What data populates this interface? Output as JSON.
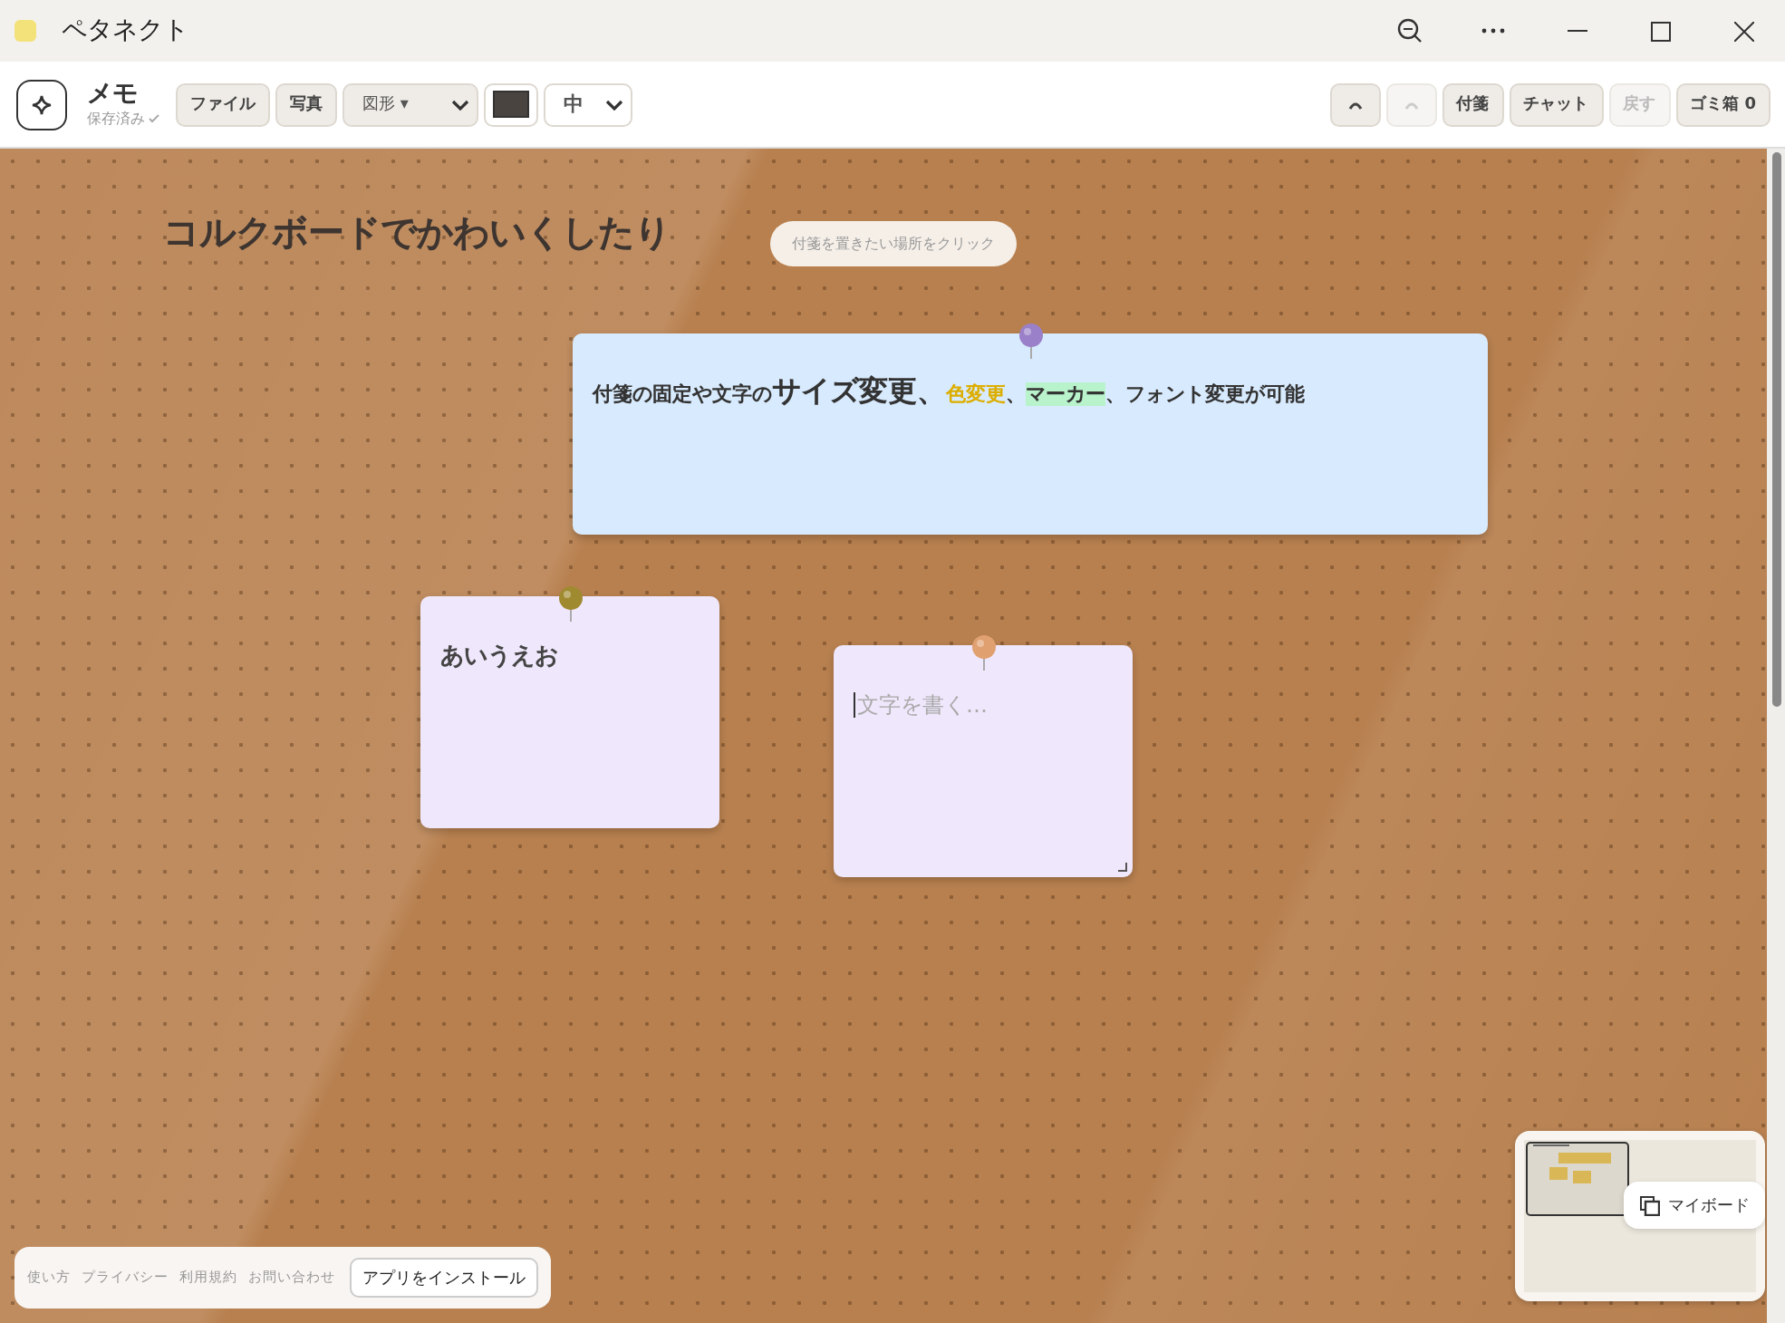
{
  "window": {
    "title": "ペタネクト"
  },
  "toolbar": {
    "app_name": "メモ",
    "save_status": "保存済み",
    "buttons_left": [
      {
        "label": "ファイル"
      },
      {
        "label": "写真"
      }
    ],
    "shape_select": {
      "value": "図形 ▾"
    },
    "pen": {
      "color": "#4a4440"
    },
    "size_select": {
      "value": "中"
    },
    "buttons_right": [
      {
        "kind": "undo",
        "disabled": false
      },
      {
        "kind": "redo",
        "disabled": true
      },
      {
        "kind": "text",
        "label": "付箋",
        "disabled": false
      },
      {
        "kind": "text",
        "label": "チャット",
        "disabled": false
      },
      {
        "kind": "text",
        "label": "戻す",
        "disabled": true
      },
      {
        "kind": "text",
        "label": "ゴミ箱 0",
        "disabled": false
      }
    ]
  },
  "board": {
    "heading": "コルクボードでかわいくしたり",
    "hint": "付箋を置きたい場所をクリック",
    "notes": [
      {
        "color": "#d8eafd",
        "pin": {
          "color": "#9a80c8"
        },
        "segments": [
          {
            "kind": "plain",
            "text": "付箋の固定や文字の"
          },
          {
            "kind": "big",
            "text": "サイズ変更、"
          },
          {
            "kind": "color",
            "text": "色変更",
            "color": "#dcae00"
          },
          {
            "kind": "plain",
            "text": "、"
          },
          {
            "kind": "marker",
            "text": "マーカー",
            "color": "#b8f3cc"
          },
          {
            "kind": "plain",
            "text": "、フォント変更が可能"
          }
        ]
      },
      {
        "color": "#efe7fc",
        "pin": {
          "color": "#a08a30"
        },
        "segments": [
          {
            "kind": "large",
            "text": "あいうえお"
          }
        ]
      },
      {
        "color": "#efe7fc",
        "pin": {
          "color": "#e0a070"
        },
        "placeholder": "文字を書く…",
        "focused": true
      }
    ]
  },
  "footer": {
    "links": [
      "使い方",
      "プライバシー",
      "利用規約",
      "お問い合わせ"
    ],
    "install_button": "アプリをインストール"
  },
  "minimap": {
    "board_button": "マイボード"
  }
}
